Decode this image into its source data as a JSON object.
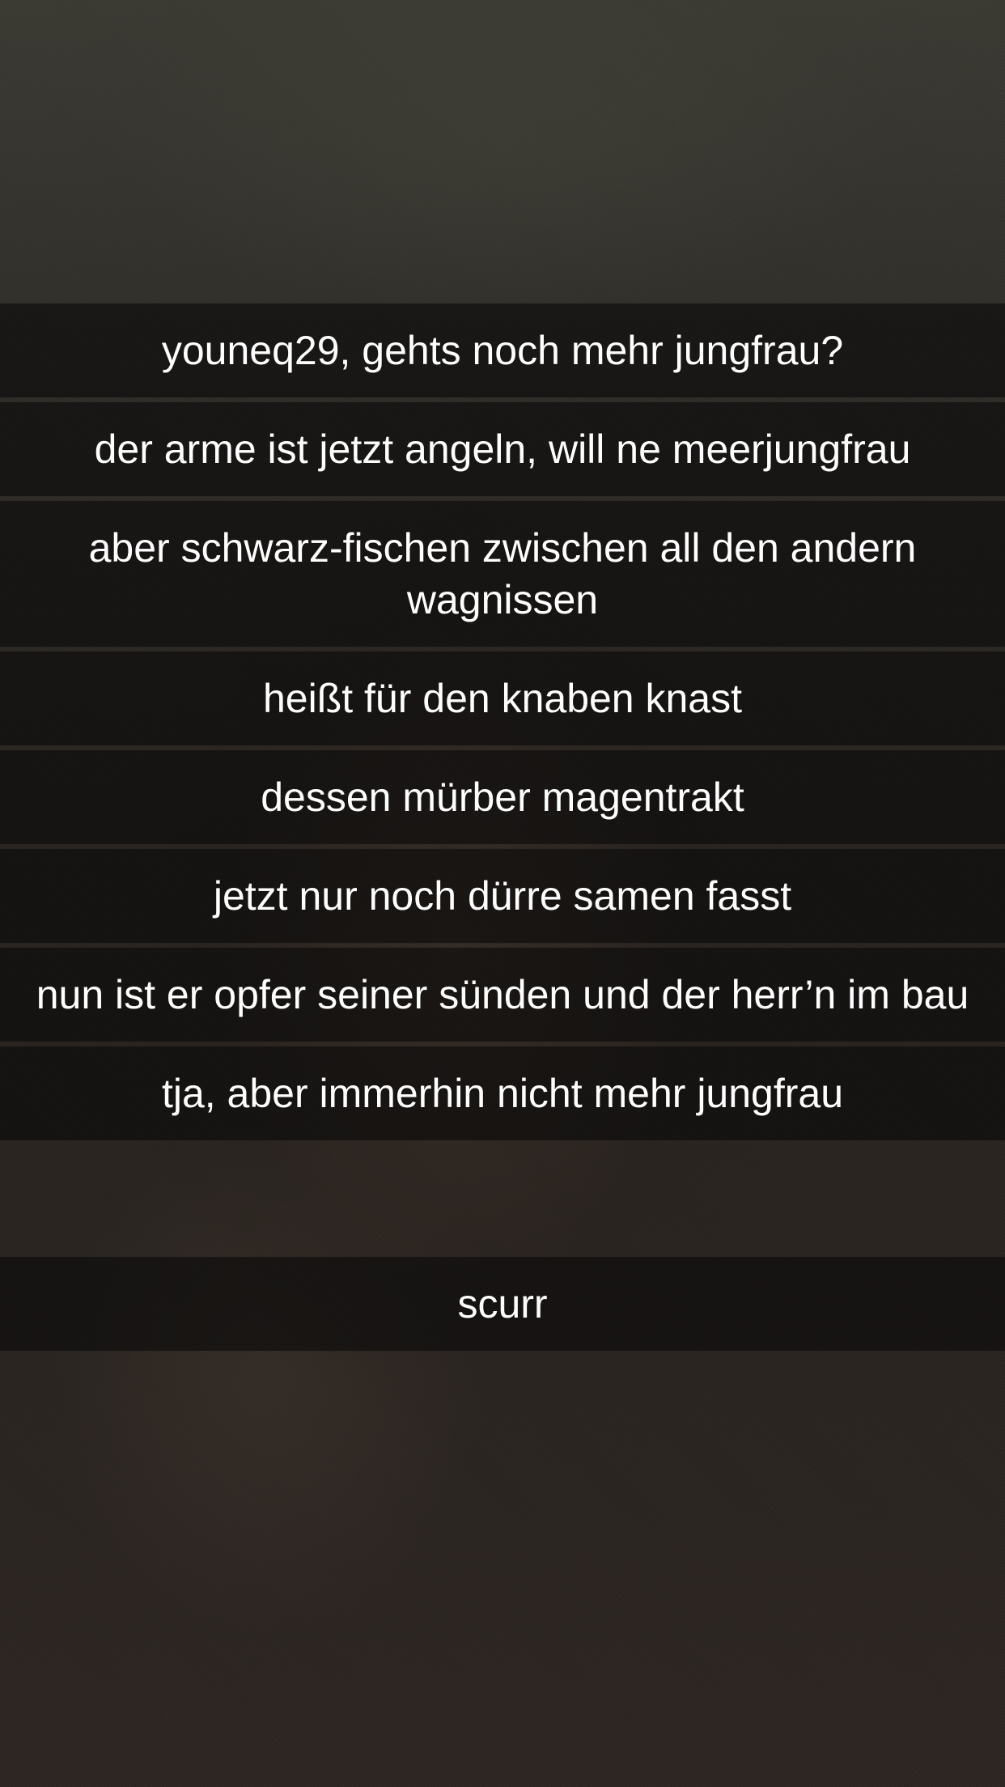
{
  "captions": [
    "youneq29, gehts noch mehr jungfrau?",
    "der arme ist jetzt angeln, will ne meerjungfrau",
    "aber schwarz-fischen zwischen all den andern wagnissen",
    "heißt für den knaben knast",
    "dessen mürber magentrakt",
    "jetzt nur noch dürre samen fasst",
    "nun ist er opfer seiner sünden und der herr’n im bau",
    "tja, aber immerhin nicht mehr jungfrau"
  ],
  "bottom_caption": "scurr",
  "colors": {
    "caption_bar": "#0a0a0a",
    "caption_text": "#ffffff",
    "background_photo": "#2c2622"
  }
}
